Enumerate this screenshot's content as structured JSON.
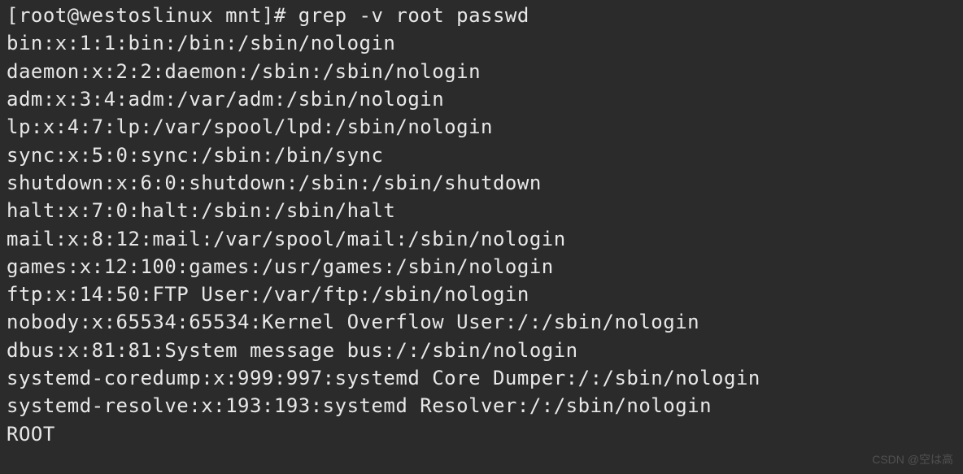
{
  "prompt": "[root@westoslinux mnt]# grep -v root passwd",
  "output_lines": [
    "bin:x:1:1:bin:/bin:/sbin/nologin",
    "daemon:x:2:2:daemon:/sbin:/sbin/nologin",
    "adm:x:3:4:adm:/var/adm:/sbin/nologin",
    "lp:x:4:7:lp:/var/spool/lpd:/sbin/nologin",
    "sync:x:5:0:sync:/sbin:/bin/sync",
    "shutdown:x:6:0:shutdown:/sbin:/sbin/shutdown",
    "halt:x:7:0:halt:/sbin:/sbin/halt",
    "mail:x:8:12:mail:/var/spool/mail:/sbin/nologin",
    "games:x:12:100:games:/usr/games:/sbin/nologin",
    "ftp:x:14:50:FTP User:/var/ftp:/sbin/nologin",
    "nobody:x:65534:65534:Kernel Overflow User:/:/sbin/nologin",
    "dbus:x:81:81:System message bus:/:/sbin/nologin",
    "systemd-coredump:x:999:997:systemd Core Dumper:/:/sbin/nologin",
    "systemd-resolve:x:193:193:systemd Resolver:/:/sbin/nologin",
    "ROOT"
  ],
  "watermark": "CSDN @空は高"
}
